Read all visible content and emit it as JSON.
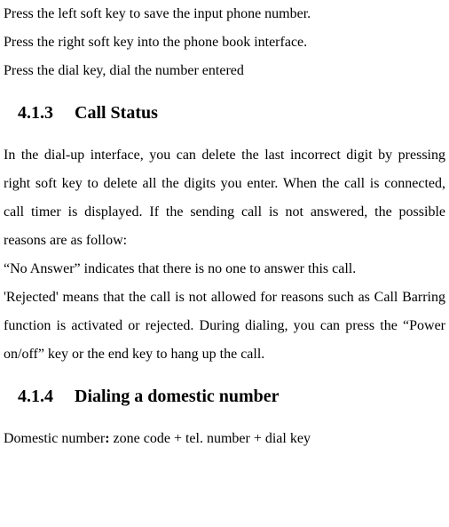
{
  "intro": {
    "line1": "Press the left soft key to save the input phone number.",
    "line2": "Press the right soft key into the phone book interface.",
    "line3": "Press the dial key, dial the number entered"
  },
  "section_413": {
    "number": "4.1.3",
    "title": "Call Status",
    "para1": "In the dial-up interface, you can delete the last incorrect digit by pressing right soft key to delete all the digits you enter. When the call is connected, call timer is displayed. If the sending call is not answered, the possible reasons are as follow:",
    "para2": "“No Answer” indicates that there is no one to answer this call.",
    "para3": "'Rejected' means that the call is not allowed for reasons such as Call Barring function is activated or rejected. During dialing, you can press the “Power on/off” key or the end key to hang up the call."
  },
  "section_414": {
    "number": "4.1.4",
    "title": "Dialing a domestic number",
    "para_prefix": "Domestic number",
    "para_colon": ":",
    "para_rest": " zone code + tel. number + dial key"
  }
}
